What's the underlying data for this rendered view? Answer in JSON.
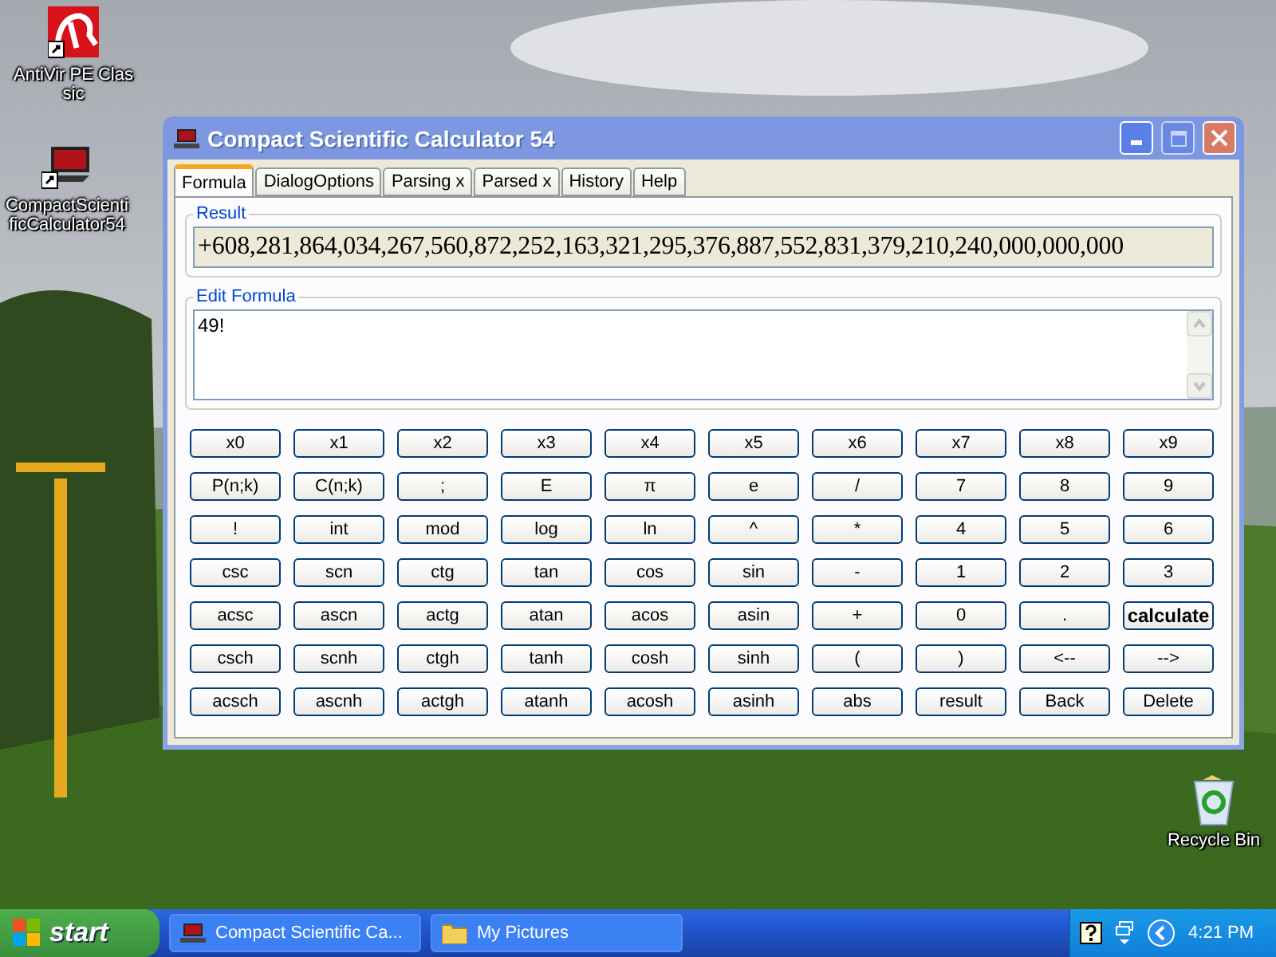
{
  "desktop_icons": [
    {
      "label": "AntiVir PE Classic",
      "kind": "antivirus"
    },
    {
      "label": "CompactScientificCalculator54",
      "kind": "laptop"
    },
    {
      "label": "Recycle Bin",
      "kind": "recycle"
    }
  ],
  "window": {
    "title": "Compact Scientific Calculator 54",
    "tabs": [
      {
        "label": "Formula",
        "selected": true
      },
      {
        "label": "DialogOptions",
        "selected": false
      },
      {
        "label": "Parsing x",
        "selected": false
      },
      {
        "label": "Parsed x",
        "selected": false
      },
      {
        "label": "History",
        "selected": false
      },
      {
        "label": "Help",
        "selected": false
      }
    ],
    "result": {
      "label": "Result",
      "value": "+608,281,864,034,267,560,872,252,163,321,295,376,887,552,831,379,210,240,000,000,000"
    },
    "edit_formula": {
      "label": "Edit Formula",
      "value": "49!"
    },
    "buttons": [
      [
        {
          "label": "x0",
          "default": false
        },
        {
          "label": "x1",
          "default": false
        },
        {
          "label": "x2",
          "default": false
        },
        {
          "label": "x3",
          "default": false
        },
        {
          "label": "x4",
          "default": false
        },
        {
          "label": "x5",
          "default": false
        },
        {
          "label": "x6",
          "default": false
        },
        {
          "label": "x7",
          "default": false
        },
        {
          "label": "x8",
          "default": false
        },
        {
          "label": "x9",
          "default": false
        }
      ],
      [
        {
          "label": "P(n;k)",
          "default": false
        },
        {
          "label": "C(n;k)",
          "default": false
        },
        {
          "label": ";",
          "default": false
        },
        {
          "label": "E",
          "default": false
        },
        {
          "label": "π",
          "default": false
        },
        {
          "label": "e",
          "default": false
        },
        {
          "label": "/",
          "default": false
        },
        {
          "label": "7",
          "default": false
        },
        {
          "label": "8",
          "default": false
        },
        {
          "label": "9",
          "default": false
        }
      ],
      [
        {
          "label": "!",
          "default": false
        },
        {
          "label": "int",
          "default": false
        },
        {
          "label": "mod",
          "default": false
        },
        {
          "label": "log",
          "default": false
        },
        {
          "label": "ln",
          "default": false
        },
        {
          "label": "^",
          "default": false
        },
        {
          "label": "*",
          "default": false
        },
        {
          "label": "4",
          "default": false
        },
        {
          "label": "5",
          "default": false
        },
        {
          "label": "6",
          "default": false
        }
      ],
      [
        {
          "label": "csc",
          "default": false
        },
        {
          "label": "scn",
          "default": false
        },
        {
          "label": "ctg",
          "default": false
        },
        {
          "label": "tan",
          "default": false
        },
        {
          "label": "cos",
          "default": false
        },
        {
          "label": "sin",
          "default": false
        },
        {
          "label": "-",
          "default": false
        },
        {
          "label": "1",
          "default": false
        },
        {
          "label": "2",
          "default": false
        },
        {
          "label": "3",
          "default": false
        }
      ],
      [
        {
          "label": "acsc",
          "default": false
        },
        {
          "label": "ascn",
          "default": false
        },
        {
          "label": "actg",
          "default": false
        },
        {
          "label": "atan",
          "default": false
        },
        {
          "label": "acos",
          "default": false
        },
        {
          "label": "asin",
          "default": false
        },
        {
          "label": "+",
          "default": false
        },
        {
          "label": "0",
          "default": false
        },
        {
          "label": ".",
          "default": false
        },
        {
          "label": "calculate",
          "default": true
        }
      ],
      [
        {
          "label": "csch",
          "default": false
        },
        {
          "label": "scnh",
          "default": false
        },
        {
          "label": "ctgh",
          "default": false
        },
        {
          "label": "tanh",
          "default": false
        },
        {
          "label": "cosh",
          "default": false
        },
        {
          "label": "sinh",
          "default": false
        },
        {
          "label": "(",
          "default": false
        },
        {
          "label": ")",
          "default": false
        },
        {
          "label": "<--",
          "default": false
        },
        {
          "label": "-->",
          "default": false
        }
      ],
      [
        {
          "label": "acsch",
          "default": false
        },
        {
          "label": "ascnh",
          "default": false
        },
        {
          "label": "actgh",
          "default": false
        },
        {
          "label": "atanh",
          "default": false
        },
        {
          "label": "acosh",
          "default": false
        },
        {
          "label": "asinh",
          "default": false
        },
        {
          "label": "abs",
          "default": false
        },
        {
          "label": "result",
          "default": false
        },
        {
          "label": "Back",
          "default": false
        },
        {
          "label": "Delete",
          "default": false
        }
      ]
    ]
  },
  "taskbar": {
    "start": "start",
    "tasks": [
      {
        "label": "Compact Scientific Ca...",
        "kind": "calculator",
        "selected": false
      },
      {
        "label": "My Pictures",
        "kind": "folder",
        "selected": false
      }
    ],
    "time": "4:21 PM"
  }
}
